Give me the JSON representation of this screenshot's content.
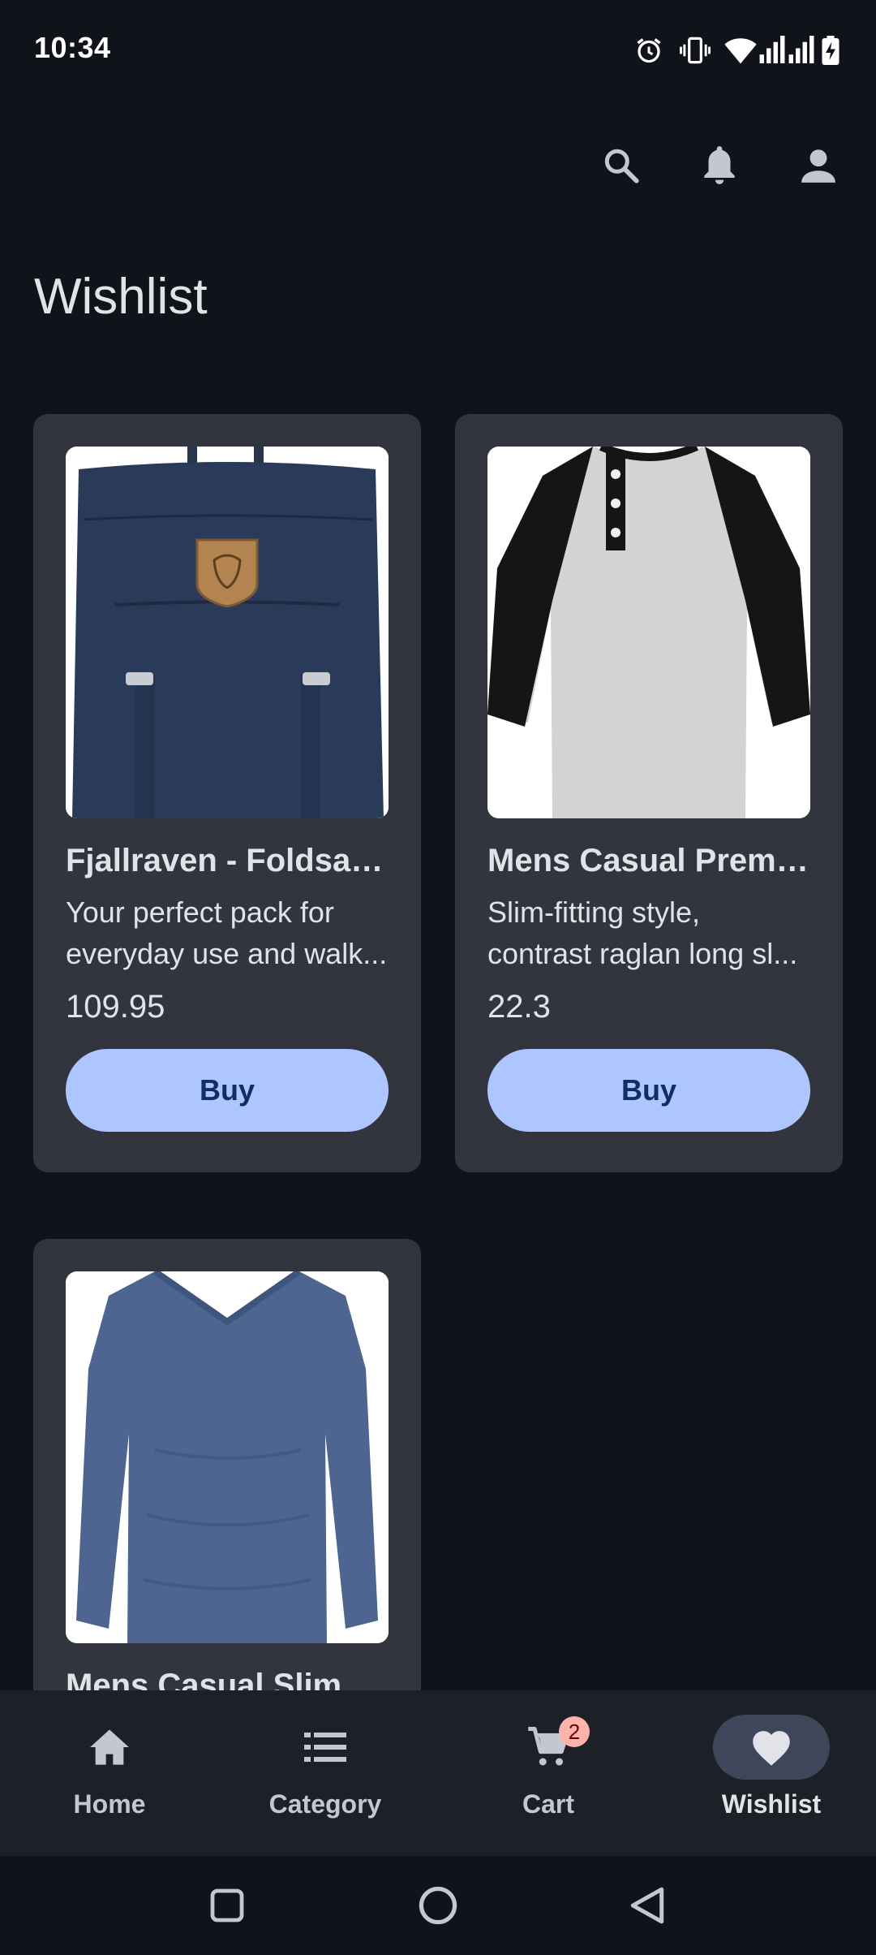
{
  "status_bar": {
    "time": "10:34",
    "icons": [
      "alarm-icon",
      "vibrate-icon",
      "wifi-icon",
      "signal-icon",
      "signal-icon",
      "battery-charging-icon"
    ]
  },
  "top_bar": {
    "actions": [
      "search-icon",
      "notifications-icon",
      "account-icon"
    ]
  },
  "page": {
    "title": "Wishlist"
  },
  "products": [
    {
      "title": "Fjallraven - Foldsac...",
      "description": "Your perfect pack for everyday use and walk...",
      "price": "109.95",
      "buy_label": "Buy",
      "image": "backpack-image"
    },
    {
      "title": "Mens Casual Premi...",
      "description": "Slim-fitting style, contrast raglan long sl...",
      "price": "22.3",
      "buy_label": "Buy",
      "image": "raglan-shirt-image"
    },
    {
      "title": "Mens Casual Slim Fit",
      "description": "",
      "price": "",
      "buy_label": "",
      "image": "long-sleeve-shirt-image"
    }
  ],
  "bottom_nav": {
    "items": [
      {
        "label": "Home",
        "icon": "home-icon"
      },
      {
        "label": "Category",
        "icon": "list-icon"
      },
      {
        "label": "Cart",
        "icon": "cart-icon",
        "badge": "2"
      },
      {
        "label": "Wishlist",
        "icon": "heart-icon",
        "active": true
      }
    ]
  },
  "system_nav": {
    "buttons": [
      "recents-button",
      "home-button",
      "back-button"
    ]
  },
  "colors": {
    "background": "#10131a",
    "card": "#32353d",
    "primary_container": "#adc6ff",
    "on_primary_container": "#102f60",
    "nav_bar": "#1d2027",
    "active_indicator": "#3e4759",
    "badge": "#ffb4ab"
  }
}
